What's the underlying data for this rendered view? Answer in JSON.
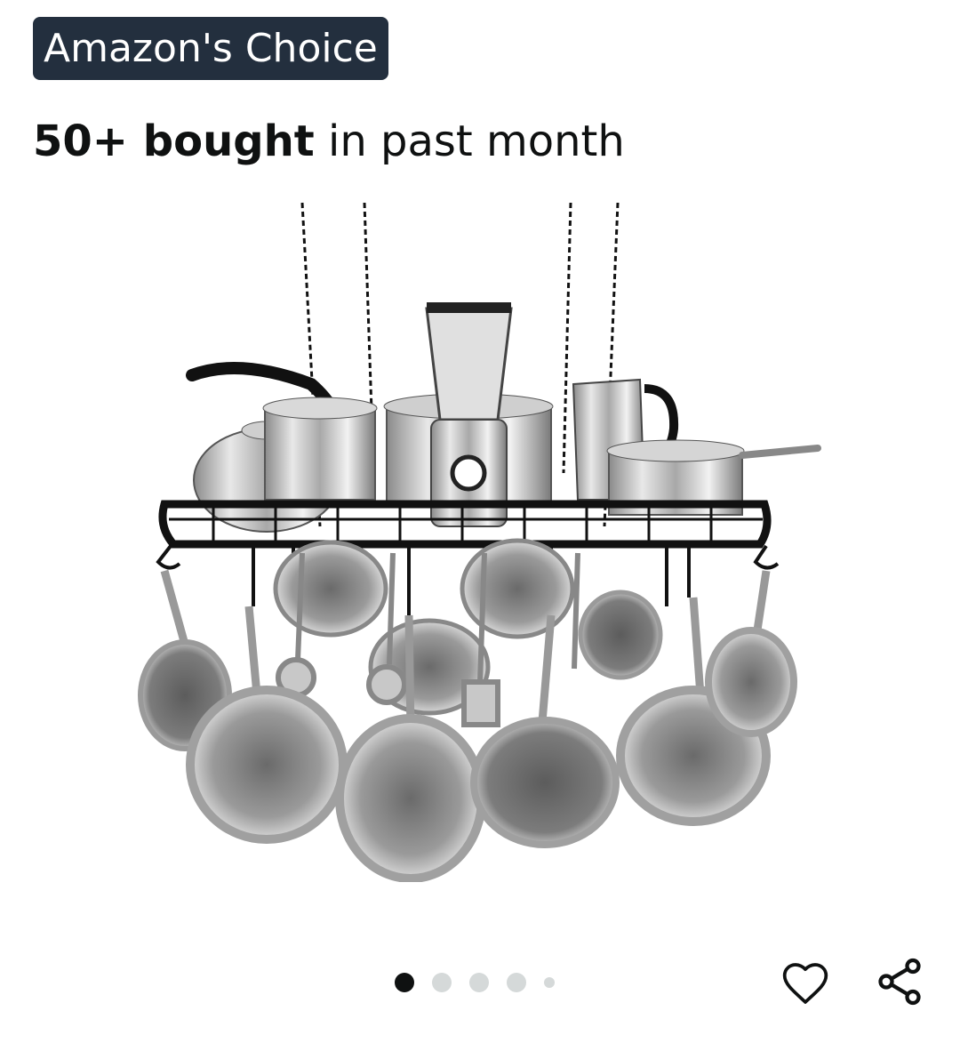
{
  "badge": {
    "label": "Amazon's Choice"
  },
  "purchase_info": {
    "count": "50+ bought",
    "suffix": " in past month"
  },
  "image_carousel": {
    "total_images": 5,
    "current_index": 1,
    "image_subject": "hanging pot rack with cookware"
  },
  "actions": {
    "favorite_icon": "heart-outline-icon",
    "share_icon": "share-icon"
  },
  "colors": {
    "badge_bg": "#232f3e",
    "badge_text": "#ffffff",
    "dot_active": "#0f1111",
    "dot_inactive": "#d5d9d9"
  }
}
